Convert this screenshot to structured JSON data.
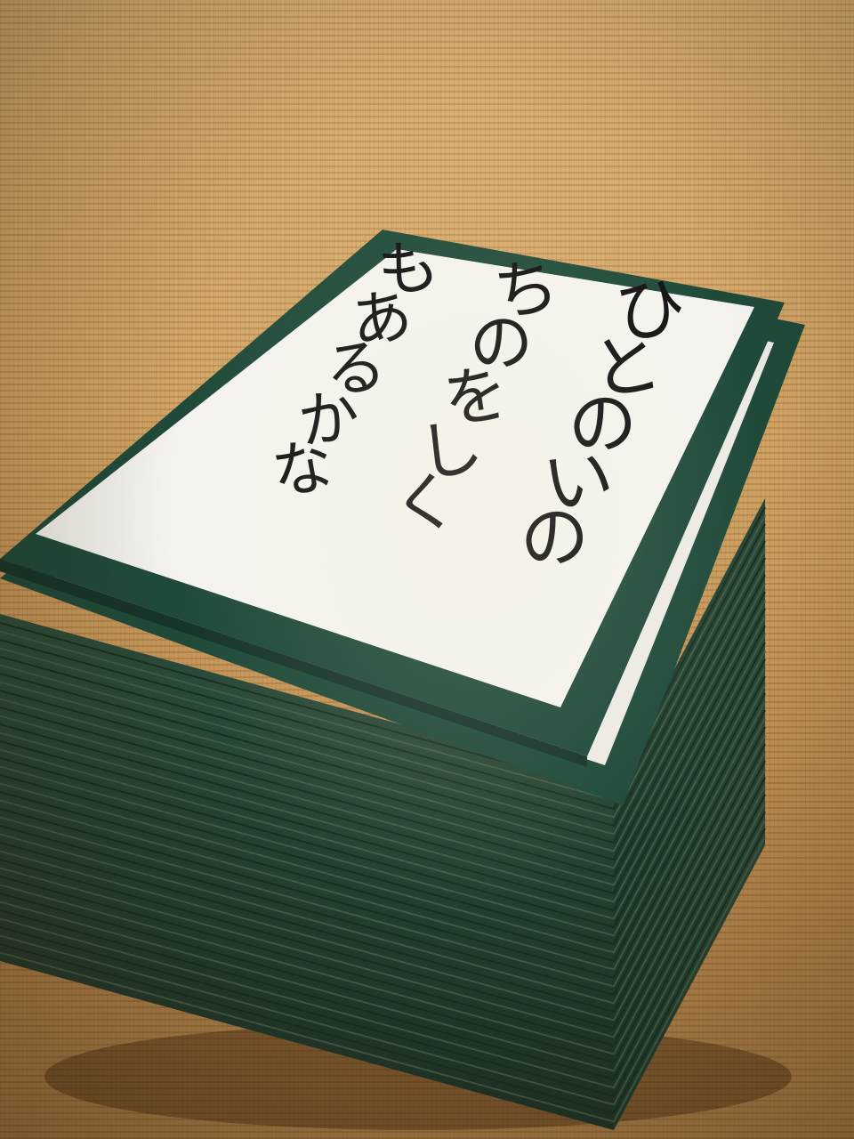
{
  "card": {
    "text_columns": [
      "ひとのいの",
      "ちのをしく",
      "もあるかな"
    ]
  },
  "colors": {
    "card_border": "#1f4a3a",
    "card_face": "#f4f3ee",
    "mat": "#c8985a",
    "text": "#111111"
  }
}
